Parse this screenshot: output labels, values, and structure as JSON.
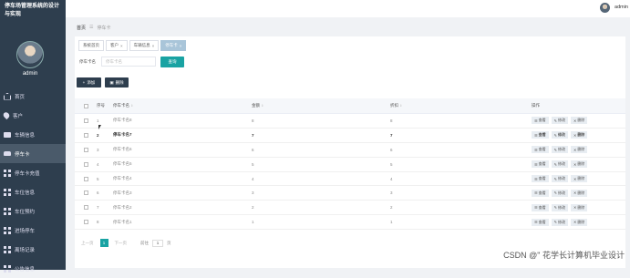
{
  "sidebar": {
    "app_title": "停车场管理系统的设计与实现",
    "admin_name": "admin",
    "items": [
      {
        "label": "首页",
        "icon": "home-icon"
      },
      {
        "label": "客户",
        "icon": "pin-icon"
      },
      {
        "label": "车辆信息",
        "icon": "monitor-icon"
      },
      {
        "label": "停车卡",
        "icon": "car-icon",
        "active": true
      },
      {
        "label": "停车卡充值",
        "icon": "grid-icon"
      },
      {
        "label": "车位信息",
        "icon": "grid-icon"
      },
      {
        "label": "车位预约",
        "icon": "grid-icon"
      },
      {
        "label": "进场停车",
        "icon": "grid-icon"
      },
      {
        "label": "离场记录",
        "icon": "grid-icon"
      },
      {
        "label": "公告信息",
        "icon": "grid-icon"
      }
    ]
  },
  "topbar": {
    "user": "admin"
  },
  "breadcrumb": {
    "home": "首页",
    "sep": "☰",
    "current": "停车卡"
  },
  "tabs": [
    {
      "label": "系统首页",
      "closable": false
    },
    {
      "label": "客户",
      "closable": true
    },
    {
      "label": "车辆信息",
      "closable": true
    },
    {
      "label": "停车卡",
      "closable": true,
      "active": true
    }
  ],
  "search": {
    "label": "停车卡名",
    "placeholder": "停车卡名",
    "button": "查询"
  },
  "toolbar": {
    "add": "添加",
    "delete": "删除"
  },
  "table": {
    "headers": {
      "no": "序号",
      "name": "停车卡名",
      "total": "金额",
      "remain": "折扣",
      "ops": "操作"
    },
    "rows": [
      {
        "no": "1",
        "name": "停车卡名8",
        "total": "8",
        "remain": "8"
      },
      {
        "no": "2",
        "name": "停车卡名7",
        "total": "7",
        "remain": "7",
        "highlight": true
      },
      {
        "no": "3",
        "name": "停车卡名6",
        "total": "6",
        "remain": "6"
      },
      {
        "no": "4",
        "name": "停车卡名5",
        "total": "5",
        "remain": "5"
      },
      {
        "no": "5",
        "name": "停车卡名4",
        "total": "4",
        "remain": "4"
      },
      {
        "no": "6",
        "name": "停车卡名3",
        "total": "3",
        "remain": "3"
      },
      {
        "no": "7",
        "name": "停车卡名2",
        "total": "2",
        "remain": "2"
      },
      {
        "no": "8",
        "name": "停车卡名1",
        "total": "1",
        "remain": "1"
      }
    ],
    "ops": {
      "view": "查看",
      "edit": "修改",
      "delete": "删除"
    }
  },
  "pager": {
    "prev": "上一页",
    "current": "1",
    "next": "下一页",
    "goto": "前往",
    "page_value": "1",
    "page_unit": "页"
  },
  "watermark": "CSDN @\" 花学长计算机毕业设计",
  "colors": {
    "sidebar": "#2e3e4e",
    "accent": "#19a3a3",
    "active_tab": "#a9c5d9"
  }
}
